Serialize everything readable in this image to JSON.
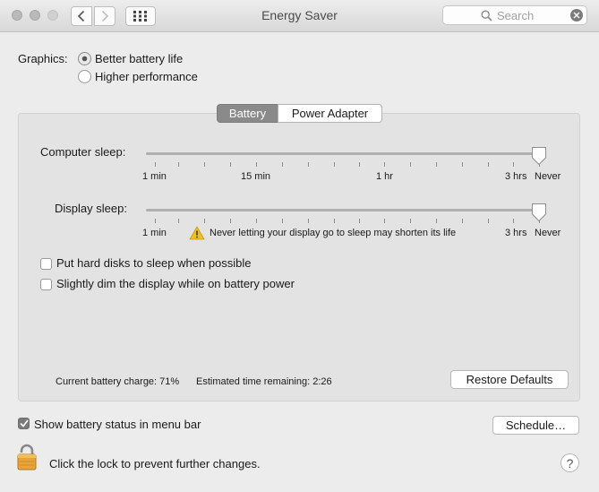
{
  "window": {
    "title": "Energy Saver",
    "search_placeholder": "Search"
  },
  "graphics": {
    "label": "Graphics:",
    "options": [
      "Better battery life",
      "Higher performance"
    ],
    "selected": "Better battery life"
  },
  "tabs": [
    "Battery",
    "Power Adapter"
  ],
  "selected_tab": "Battery",
  "computer_sleep": {
    "label": "Computer sleep:",
    "value": "Never",
    "labels": [
      "1 min",
      "15 min",
      "1 hr",
      "3 hrs",
      "Never"
    ]
  },
  "display_sleep": {
    "label": "Display sleep:",
    "value": "Never",
    "labels": [
      "1 min",
      "3 hrs",
      "Never"
    ],
    "warning": "Never letting your display go to sleep may shorten its life"
  },
  "options": {
    "hard_disks": {
      "label": "Put hard disks to sleep when possible",
      "checked": false
    },
    "dim_display": {
      "label": "Slightly dim the display while on battery power",
      "checked": false
    }
  },
  "status": {
    "charge": "Current battery charge: 71%",
    "remaining": "Estimated time remaining: 2:26"
  },
  "buttons": {
    "restore": "Restore Defaults",
    "schedule": "Schedule…"
  },
  "menu_bar_status": {
    "label": "Show battery status in menu bar",
    "checked": true
  },
  "lock_text": "Click the lock to prevent further changes.",
  "help_label": "?",
  "icons": [
    "close-icon",
    "minimize-icon",
    "zoom-icon",
    "back-icon",
    "forward-icon",
    "grid-icon",
    "search-icon",
    "clear-icon",
    "warning-icon",
    "lock-icon",
    "checkmark-icon"
  ]
}
